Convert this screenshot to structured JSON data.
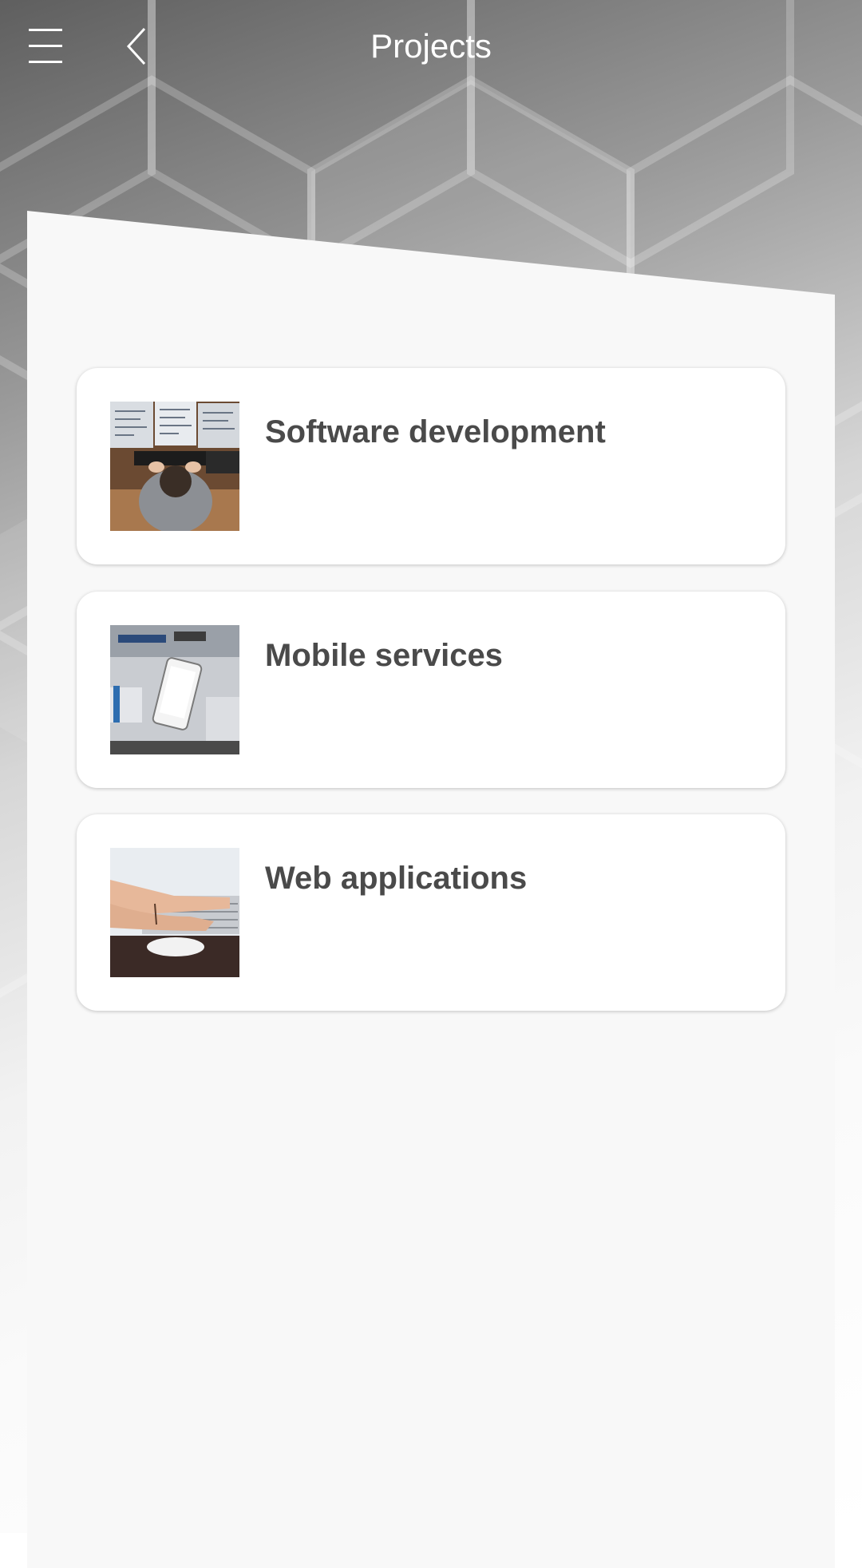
{
  "header": {
    "title": "Projects",
    "menu_icon": "hamburger-menu-icon",
    "back_icon": "chevron-left-icon"
  },
  "projects": [
    {
      "label": "Software development",
      "image": "developer-at-multiple-monitors-photo"
    },
    {
      "label": "Mobile services",
      "image": "smartphone-repair-photo"
    },
    {
      "label": "Web applications",
      "image": "hands-typing-on-laptop-photo"
    }
  ],
  "colors": {
    "title_text": "#ffffff",
    "card_text": "#4a4a4a",
    "panel_bg": "#f8f8f8",
    "card_bg": "#ffffff"
  }
}
